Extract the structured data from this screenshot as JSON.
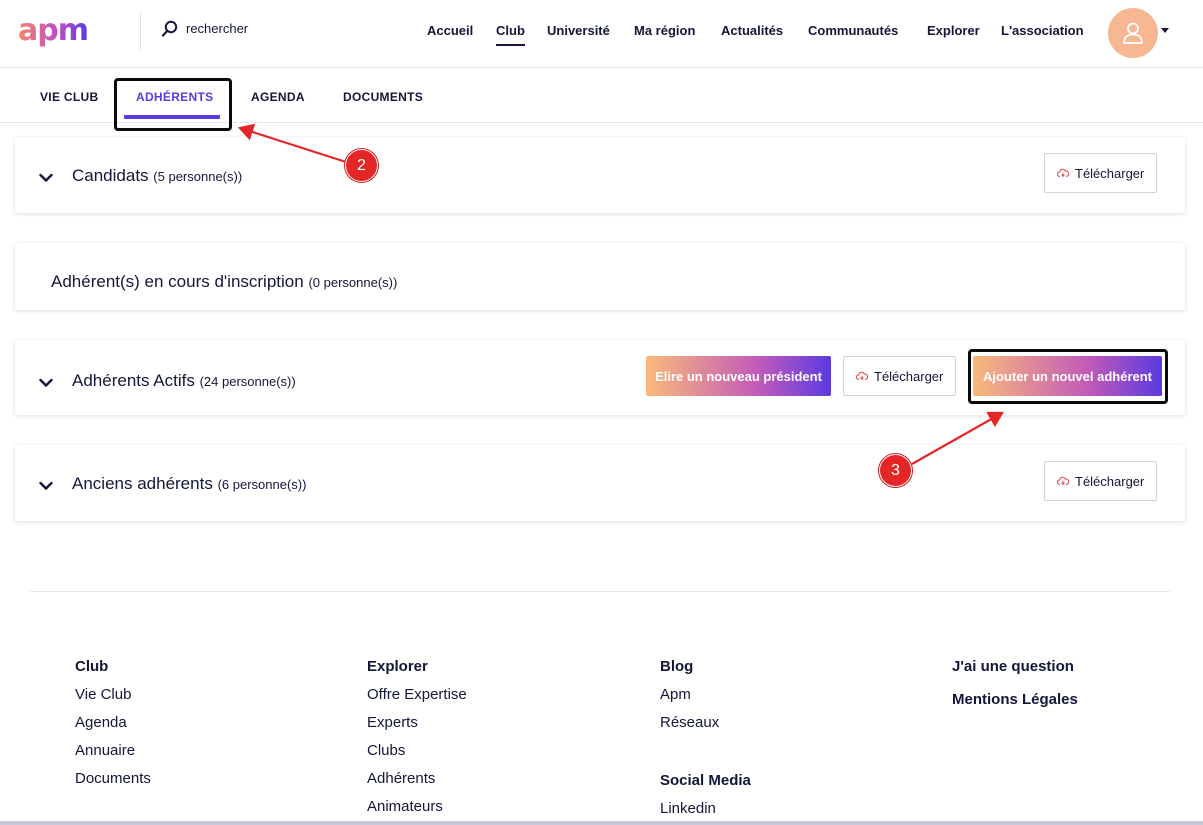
{
  "header": {
    "logo_text": "apm",
    "search": {
      "placeholder": "rechercher"
    },
    "nav": [
      {
        "label": "Accueil",
        "active": false
      },
      {
        "label": "Club",
        "active": true
      },
      {
        "label": "Université",
        "active": false
      },
      {
        "label": "Ma région",
        "active": false
      },
      {
        "label": "Actualités",
        "active": false
      },
      {
        "label": "Communautés",
        "active": false
      },
      {
        "label": "Explorer",
        "active": false
      },
      {
        "label": "L'association",
        "active": false
      }
    ],
    "avatar_icon": "user-icon"
  },
  "tabs": [
    {
      "label": "VIE CLUB",
      "active": false
    },
    {
      "label": "ADHÉRENTS",
      "active": true
    },
    {
      "label": "AGENDA",
      "active": false
    },
    {
      "label": "DOCUMENTS",
      "active": false
    }
  ],
  "sections": {
    "candidats": {
      "title": "Candidats",
      "count": "(5 personne(s))",
      "download_label": "Télécharger"
    },
    "en_cours": {
      "title": "Adhérent(s) en cours d'inscription",
      "count": "(0 personne(s))"
    },
    "actifs": {
      "title": "Adhérents Actifs",
      "count": "(24 personne(s))",
      "elect_label": "Elire un nouveau président",
      "download_label": "Télécharger",
      "add_label": "Ajouter un nouvel adhérent"
    },
    "anciens": {
      "title": "Anciens adhérents",
      "count": "(6 personne(s))",
      "download_label": "Télécharger"
    }
  },
  "annotations": {
    "marker_2": "2",
    "marker_3": "3"
  },
  "footer": {
    "club": {
      "title": "Club",
      "links": [
        "Vie Club",
        "Agenda",
        "Annuaire",
        "Documents"
      ]
    },
    "explorer": {
      "title": "Explorer",
      "links": [
        "Offre Expertise",
        "Experts",
        "Clubs",
        "Adhérents",
        "Animateurs"
      ]
    },
    "blog": {
      "title": "Blog",
      "links": [
        "Apm",
        "Réseaux"
      ]
    },
    "social": {
      "title": "Social Media",
      "links": [
        "Linkedin"
      ]
    },
    "misc": {
      "question": "J'ai une question",
      "legal": "Mentions Légales"
    }
  },
  "colors": {
    "brand_dark": "#14163a",
    "accent_purple": "#5b3be0",
    "gradient_start": "#f9b97a",
    "gradient_end": "#5b3be0",
    "annotation_red": "#e42626",
    "cloud_icon": "#e4505a"
  }
}
